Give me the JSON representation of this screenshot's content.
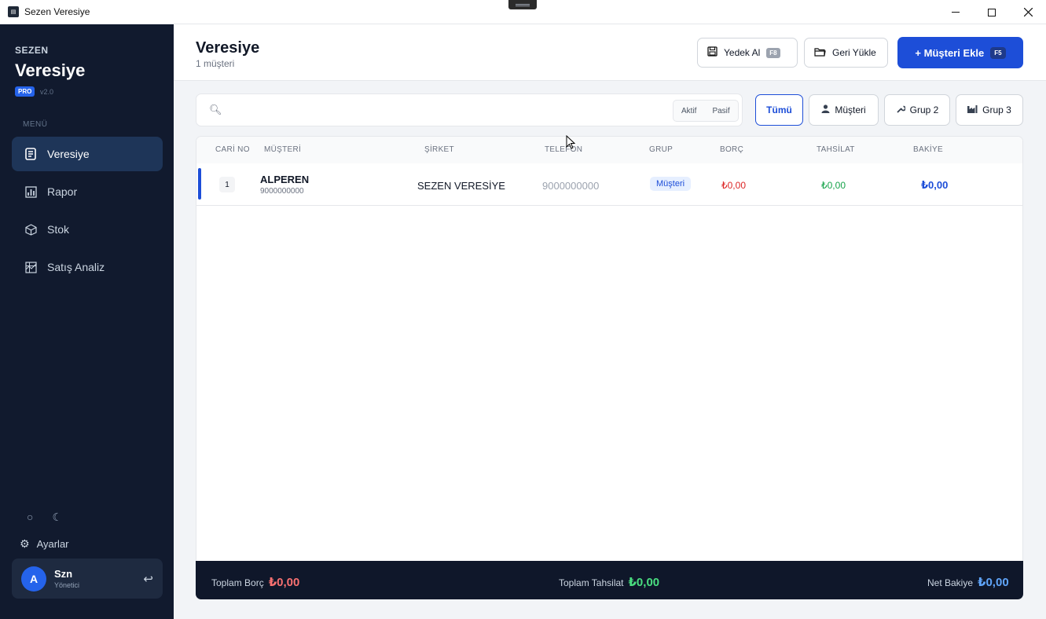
{
  "window": {
    "title": "Sezen Veresiye",
    "app_icon": "app-icon"
  },
  "sidebar": {
    "brand_small": "SEZEN",
    "brand_big": "Veresiye",
    "badge": "PRO",
    "version": "v2.0",
    "menu_label": "MENÜ",
    "items": [
      {
        "label": "Veresiye",
        "icon": "ledger-icon",
        "active": true
      },
      {
        "label": "Rapor",
        "icon": "chart-icon",
        "active": false
      },
      {
        "label": "Stok",
        "icon": "box-icon",
        "active": false
      },
      {
        "label": "Satış Analiz",
        "icon": "analysis-icon",
        "active": false
      }
    ],
    "settings_label": "Ayarlar",
    "user": {
      "initial": "A",
      "name": "Szn",
      "role": "Yönetici"
    }
  },
  "header": {
    "title": "Veresiye",
    "subtitle": "1 müşteri",
    "backup_label": "Yedek Al",
    "backup_key": "F8",
    "restore_label": "Geri Yükle",
    "add_label": "+ Müşteri Ekle",
    "add_key": "F5"
  },
  "search": {
    "placeholder": "",
    "value": "",
    "toggle": [
      "Aktif",
      "Pasif"
    ]
  },
  "filters": [
    {
      "label": "Tümü",
      "active": true
    },
    {
      "label": "Müşteri",
      "icon": "person-icon"
    },
    {
      "label": "Grup 2",
      "icon": "wrench-icon"
    },
    {
      "label": "Grup 3",
      "icon": "factory-icon"
    }
  ],
  "table": {
    "columns": [
      "CARİ NO",
      "MÜŞTERİ",
      "ŞİRKET",
      "TELEFON",
      "GRUP",
      "BORÇ",
      "TAHSİLAT",
      "BAKİYE"
    ],
    "rows": [
      {
        "no": "1",
        "name": "ALPEREN",
        "name_phone": "9000000000",
        "company": "SEZEN VERESİYE",
        "phone": "9000000000",
        "group": "Müşteri",
        "borc": "₺0,00",
        "tahsilat": "₺0,00",
        "bakiye": "₺0,00"
      }
    ]
  },
  "totals": {
    "borc_label": "Toplam Borç",
    "borc_value": "₺0,00",
    "tahsilat_label": "Toplam Tahsilat",
    "tahsilat_value": "₺0,00",
    "net_label": "Net Bakiye",
    "net_value": "₺0,00"
  },
  "colors": {
    "sidebar_bg": "#111a2e",
    "accent": "#1d4ed8",
    "debt": "#dc2626",
    "collection": "#16a34a",
    "footer_bg": "#0f172a"
  }
}
